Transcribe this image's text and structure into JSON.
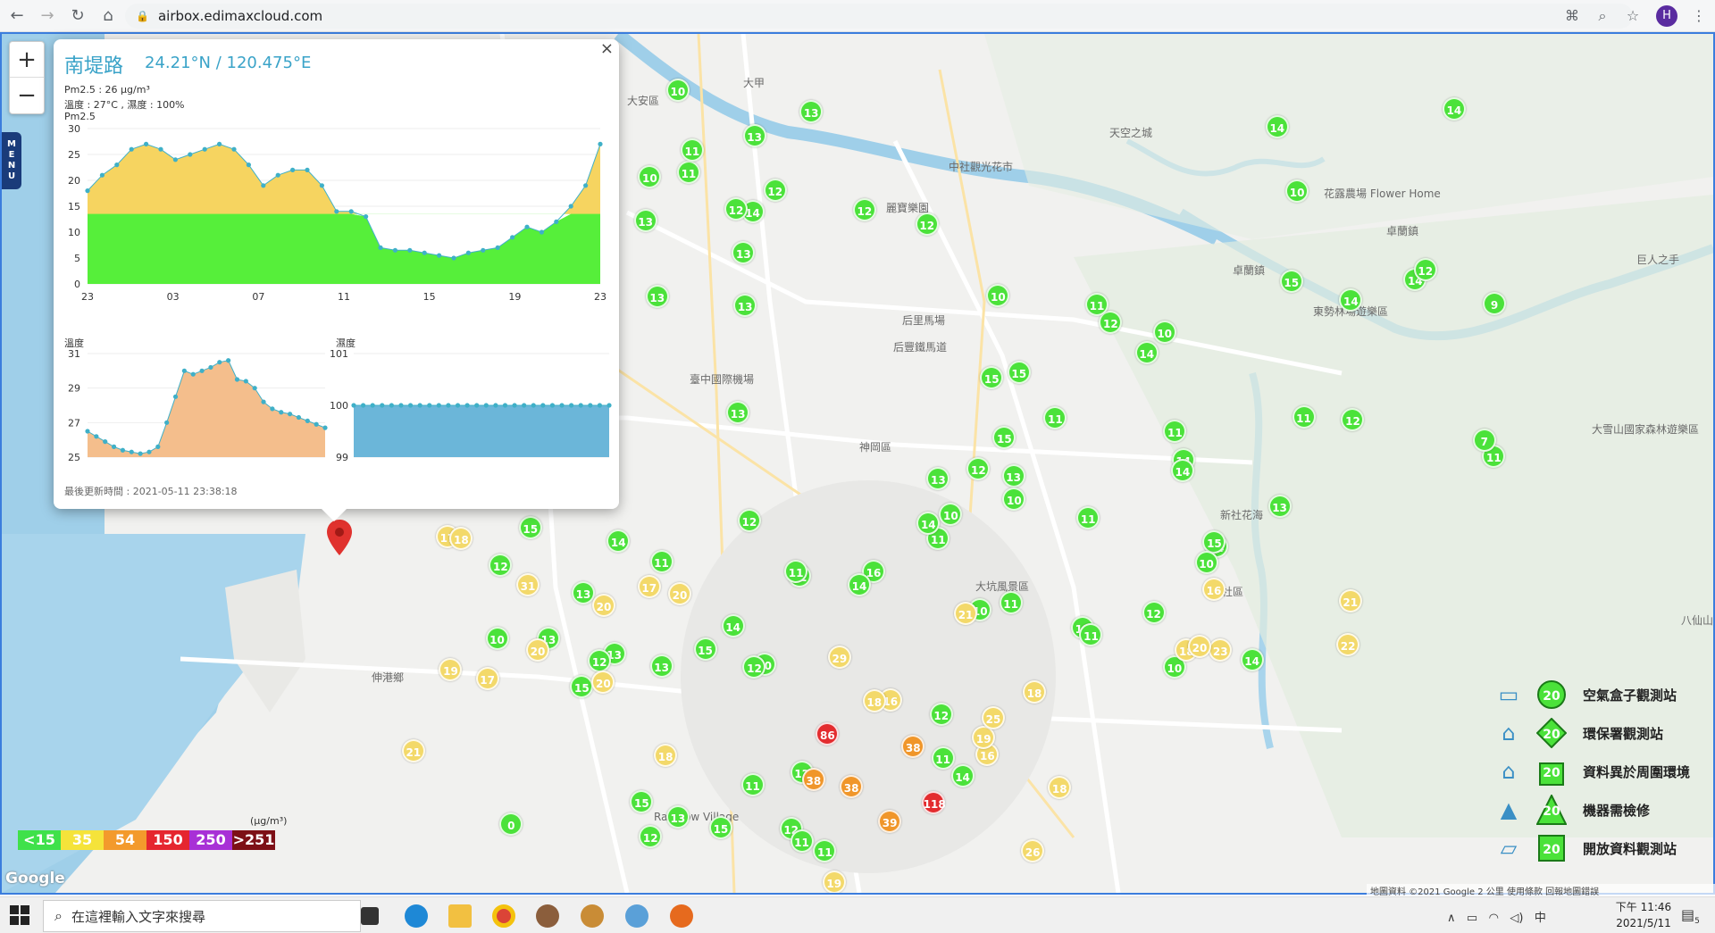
{
  "browser": {
    "url": "airbox.edimaxcloud.com",
    "profile_initial": "H"
  },
  "popup": {
    "close": "×",
    "title": "南堤路",
    "coords": "24.21°N / 120.475°E",
    "pm25_line": "Pm2.5 : 26 μg/m³",
    "temp_hum_line": "溫度 : 27°C , 濕度 : 100%",
    "pm_label": "Pm2.5",
    "temp_label": "溫度",
    "hum_label": "濕度",
    "updated": "最後更新時間 : 2021-05-11 23:38:18"
  },
  "chart_data": [
    {
      "type": "area",
      "title": "Pm2.5",
      "x_ticks": [
        "23",
        "03",
        "07",
        "11",
        "15",
        "19",
        "23"
      ],
      "ylim": [
        0,
        30
      ],
      "y_ticks": [
        0,
        5,
        10,
        15,
        20,
        25,
        30
      ],
      "values": [
        18,
        21,
        23,
        26,
        27,
        26,
        24,
        25,
        26,
        27,
        26,
        23,
        19,
        21,
        22,
        22,
        19,
        14,
        14,
        13,
        7,
        6.5,
        6.5,
        6,
        5.5,
        5,
        6,
        6.5,
        7,
        9,
        11,
        10,
        12,
        15,
        19,
        27
      ],
      "threshold": 13.5,
      "colors": {
        "above": "#f6d460",
        "below": "#56ef3a",
        "line": "#3fb0c8"
      }
    },
    {
      "type": "area",
      "title": "溫度",
      "ylim": [
        25,
        31
      ],
      "y_ticks": [
        25,
        27,
        29,
        31
      ],
      "values": [
        26.5,
        26.2,
        25.9,
        25.6,
        25.4,
        25.3,
        25.2,
        25.3,
        25.6,
        27.0,
        28.5,
        30.0,
        29.8,
        30.0,
        30.2,
        30.5,
        30.6,
        29.5,
        29.4,
        29.0,
        28.2,
        27.8,
        27.6,
        27.5,
        27.3,
        27.1,
        26.9,
        26.7
      ],
      "colors": {
        "fill": "#f4be8c",
        "line": "#3fb0c8"
      }
    },
    {
      "type": "bar",
      "title": "濕度",
      "ylim": [
        99,
        101
      ],
      "y_ticks": [
        99,
        100,
        101
      ],
      "values": [
        100,
        100,
        100,
        100,
        100,
        100,
        100,
        100,
        100,
        100,
        100,
        100,
        100,
        100,
        100,
        100,
        100,
        100,
        100,
        100,
        100,
        100,
        100,
        100,
        100,
        100,
        100,
        100
      ],
      "colors": {
        "fill": "#6bb6d9",
        "line": "#3fb0c8"
      }
    }
  ],
  "map_labels": {
    "a1": "大安區",
    "a2": "大甲",
    "a3": "中社觀光花市",
    "a4": "麗寶樂園",
    "a5": "花露農場 Flower Home",
    "a6": "卓蘭鎮",
    "a7": "卓蘭鎮",
    "a8": "東勢林場遊樂區",
    "a9": "后里馬場",
    "a10": "后豐鐵馬道",
    "a11": "臺中國際機場",
    "a12": "大雪山國家森林遊樂區",
    "a13": "新社花海",
    "a14": "新社區",
    "a15": "伸港鄉",
    "a16": "大坑風景區",
    "a17": "巨人之手",
    "a18": "天空之城",
    "a19": "神岡區",
    "a20": "Rainbow Village",
    "a21": "八仙山"
  },
  "markers_green": [
    "14",
    "12",
    "15",
    "0",
    "14",
    "12",
    "16",
    "13",
    "13",
    "15",
    "15",
    "14",
    "15",
    "10",
    "12",
    "11",
    "14",
    "13",
    "11",
    "11",
    "10",
    "13",
    "12",
    "10",
    "13",
    "14",
    "10",
    "12",
    "10",
    "12",
    "12",
    "15",
    "12",
    "14",
    "14",
    "13",
    "12",
    "11",
    "13",
    "15",
    "14",
    "12",
    "11",
    "11",
    "10",
    "10",
    "14",
    "13",
    "11",
    "12",
    "11",
    "11",
    "12",
    "10",
    "11",
    "15",
    "10",
    "13",
    "13",
    "11",
    "10",
    "14",
    "13",
    "11",
    "12",
    "12",
    "14",
    "14",
    "12",
    "15",
    "13",
    "11",
    "11",
    "13",
    "12",
    "14",
    "15",
    "13",
    "14",
    "10",
    "12",
    "11",
    "9",
    "14",
    "13",
    "11",
    "15",
    "12",
    "10",
    "7",
    "11",
    "12"
  ],
  "markers_yellow": [
    "16",
    "18",
    "17",
    "22",
    "16",
    "19",
    "17",
    "31",
    "16",
    "18",
    "19",
    "20",
    "21",
    "23",
    "26",
    "18",
    "20",
    "19",
    "21",
    "25",
    "29",
    "20",
    "17",
    "18",
    "18",
    "21",
    "20",
    "18",
    "20"
  ],
  "markers_orange": [
    "38",
    "38",
    "38",
    "39"
  ],
  "markers_red": [
    "86",
    "118"
  ],
  "legend": [
    {
      "icon": "airbox-icon",
      "label": "空氣盒子觀測站",
      "shape": "circle",
      "value": "20"
    },
    {
      "icon": "government-icon",
      "label": "環保署觀測站",
      "shape": "diamond",
      "value": "20"
    },
    {
      "icon": "house-icon",
      "label": "資料異於周圍環境",
      "shape": "pentagon",
      "value": "20"
    },
    {
      "icon": "tower-icon",
      "label": "機器需檢修",
      "shape": "triangle",
      "value": "20"
    },
    {
      "icon": "open-data-icon",
      "label": "開放資料觀測站",
      "shape": "square",
      "value": "20"
    }
  ],
  "scale": {
    "unit": "(μg/m³)",
    "levels": [
      {
        "label": "<15",
        "color": "#3fe14a"
      },
      {
        "label": "35",
        "color": "#f5e33a"
      },
      {
        "label": "54",
        "color": "#f39a2c"
      },
      {
        "label": "150",
        "color": "#e5262f"
      },
      {
        "label": "250",
        "color": "#a830d6"
      },
      {
        "label": ">251",
        "color": "#7d1016"
      }
    ]
  },
  "attribution": "地圖資料 ©2021 Google    2 公里          使用條款    回報地圖錯誤",
  "google_logo": "Google",
  "taskbar": {
    "search_placeholder": "在這裡輸入文字來搜尋",
    "time": "下午 11:46",
    "date": "2021/5/11",
    "ime": "中",
    "notif_count": "5"
  }
}
